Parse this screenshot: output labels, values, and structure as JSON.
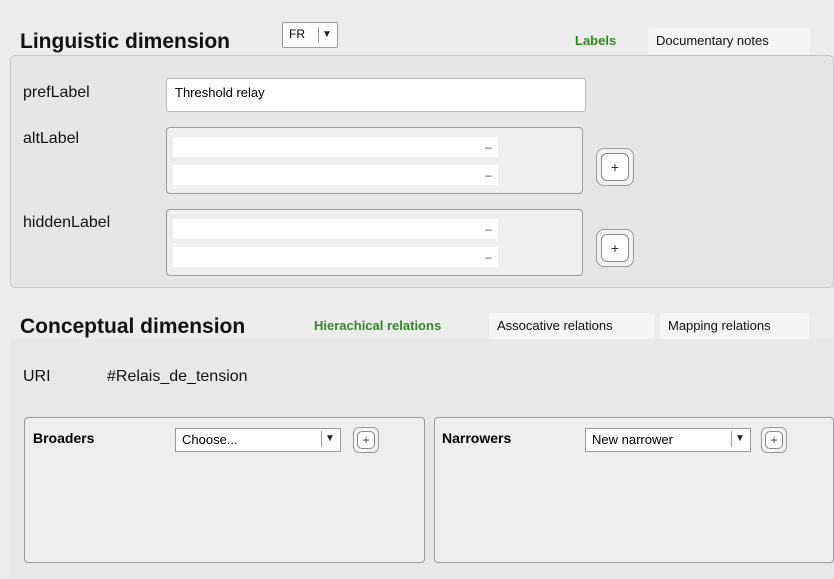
{
  "linguistic": {
    "title": "Linguistic dimension",
    "language": "FR",
    "tabs": {
      "labels": "Labels",
      "notes": "Documentary notes"
    },
    "pref_label": "prefLabel",
    "pref_value": "Threshold relay",
    "alt_label": "altLabel",
    "hidden_label": "hiddenLabel",
    "minus": "–",
    "plus": "+"
  },
  "conceptual": {
    "title": "Conceptual dimension",
    "tabs": {
      "hierarchical": "Hierachical relations",
      "associative": "Assocative relations",
      "mapping": "Mapping relations"
    },
    "uri_label": "URI",
    "uri_value": "#Relais_de_tension",
    "broaders": {
      "label": "Broaders",
      "select": "Choose...",
      "plus": "+"
    },
    "narrowers": {
      "label": "Narrowers",
      "select": "New narrower",
      "plus": "+"
    }
  }
}
